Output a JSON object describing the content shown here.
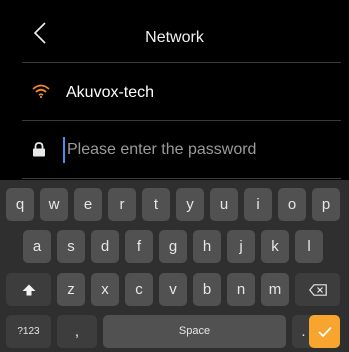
{
  "header": {
    "title": "Network",
    "back_icon": "chevron-left-icon"
  },
  "network": {
    "ssid": "Akuvox-tech",
    "wifi_icon": "wifi-icon",
    "wifi_color": "#f0892e"
  },
  "password": {
    "placeholder": "Please enter the password",
    "value": "",
    "lock_icon": "lock-icon"
  },
  "keyboard": {
    "row1": [
      "q",
      "w",
      "e",
      "r",
      "t",
      "y",
      "u",
      "i",
      "o",
      "p"
    ],
    "row2": [
      "a",
      "s",
      "d",
      "f",
      "g",
      "h",
      "j",
      "k",
      "l"
    ],
    "row3": [
      "z",
      "x",
      "c",
      "v",
      "b",
      "n",
      "m"
    ],
    "shift_icon": "shift-up-arrow-icon",
    "backspace_icon": "backspace-icon",
    "symbols_label": "?123",
    "comma_label": ",",
    "space_label": "Space",
    "period_label": ".",
    "done_icon": "checkmark-icon",
    "done_color": "#f7a52e"
  }
}
